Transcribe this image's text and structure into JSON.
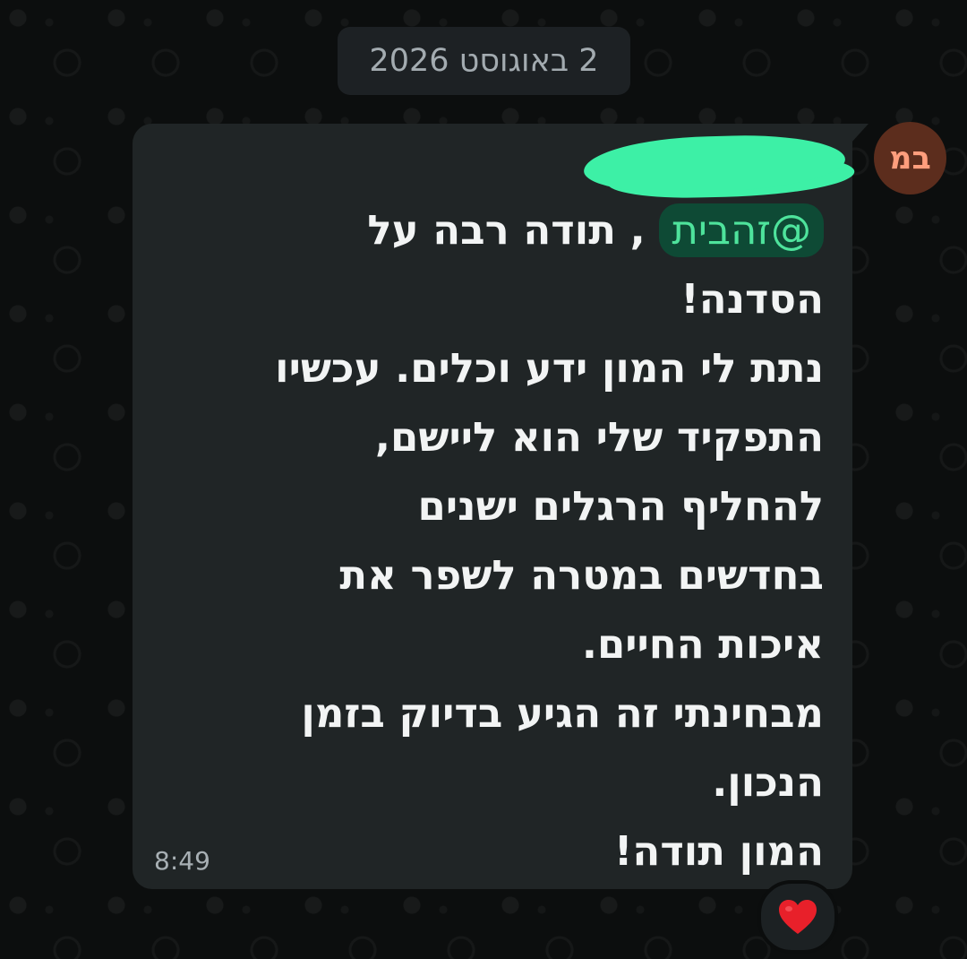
{
  "date_separator": "2 באוגוסט 2026",
  "sender": {
    "avatar_initials": "במ",
    "avatar_color": "#5c2d1d",
    "avatar_text_color": "#ff9e7d"
  },
  "message": {
    "mention": "@זהבית",
    "line1_rest": " , תודה רבה על",
    "lines": [
      "הסדנה!",
      "נתת לי המון ידע וכלים. עכשיו",
      "התפקיד שלי הוא ליישם,",
      "להחליף הרגלים ישנים",
      "בחדשים במטרה לשפר את",
      "איכות החיים.",
      "מבחינתי זה הגיע בדיוק בזמן",
      "הנכון.",
      "המון תודה!"
    ],
    "time": "8:49",
    "bubble_color": "#202526",
    "mention_color": "#4ee39c"
  },
  "reaction": {
    "icon": "red-heart-icon",
    "color": "#e8202a"
  }
}
